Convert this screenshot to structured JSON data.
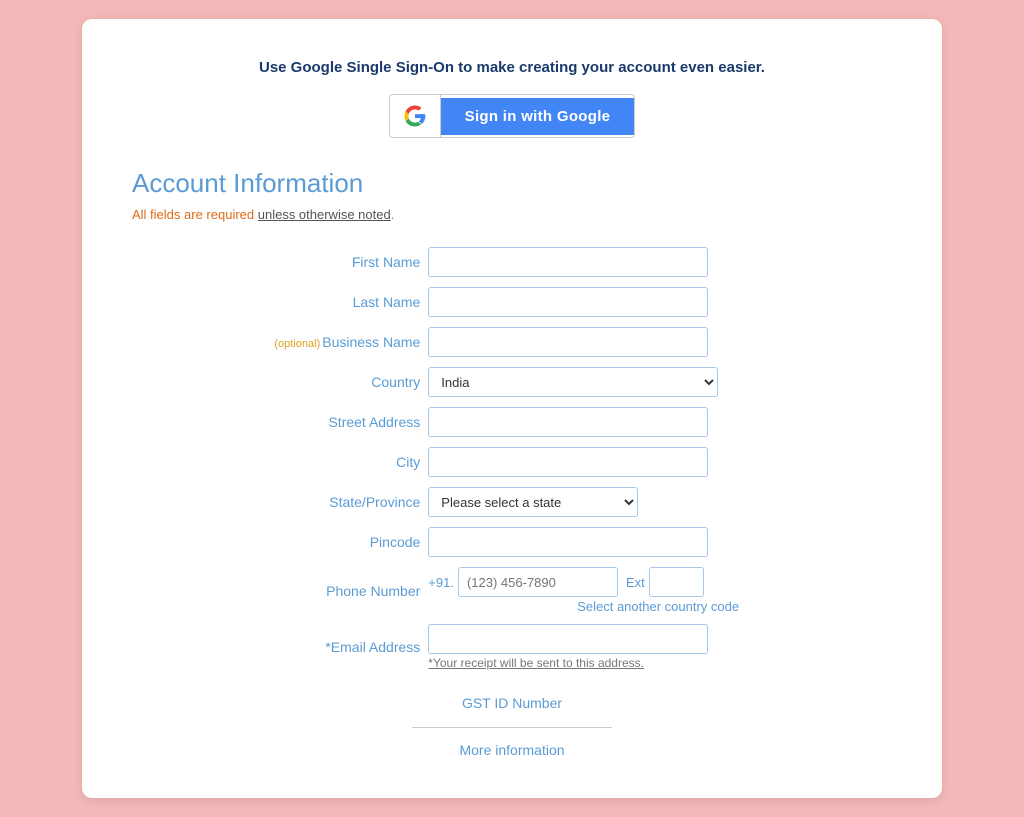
{
  "page": {
    "background_color": "#f4b8b8"
  },
  "sso": {
    "title": "Use Google Single Sign-On to make creating your account even easier.",
    "button_label": "Sign in with Google",
    "google_icon_alt": "Google G logo"
  },
  "account_section": {
    "heading": "Account Information",
    "fields_note_prefix": "All fields are required ",
    "fields_note_link": "unless otherwise noted",
    "fields_note_suffix": ".",
    "fields": {
      "first_name_label": "First Name",
      "last_name_label": "Last Name",
      "business_name_label": "Business Name",
      "business_name_optional": "(optional)",
      "country_label": "Country",
      "country_value": "India",
      "street_address_label": "Street Address",
      "city_label": "City",
      "state_label": "State/Province",
      "state_placeholder": "Please select a state",
      "pincode_label": "Pincode",
      "phone_label": "Phone Number",
      "phone_prefix": "+91.",
      "phone_placeholder": "(123) 456-7890",
      "ext_label": "Ext",
      "select_country_code": "Select another country code",
      "email_label": "*Email Address",
      "email_note_prefix": "*Your receipt ",
      "email_note_link": "will",
      "email_note_suffix": " be sent to this address."
    }
  },
  "gst": {
    "link_label": "GST ID Number"
  },
  "more_info": {
    "link_label": "More information"
  }
}
